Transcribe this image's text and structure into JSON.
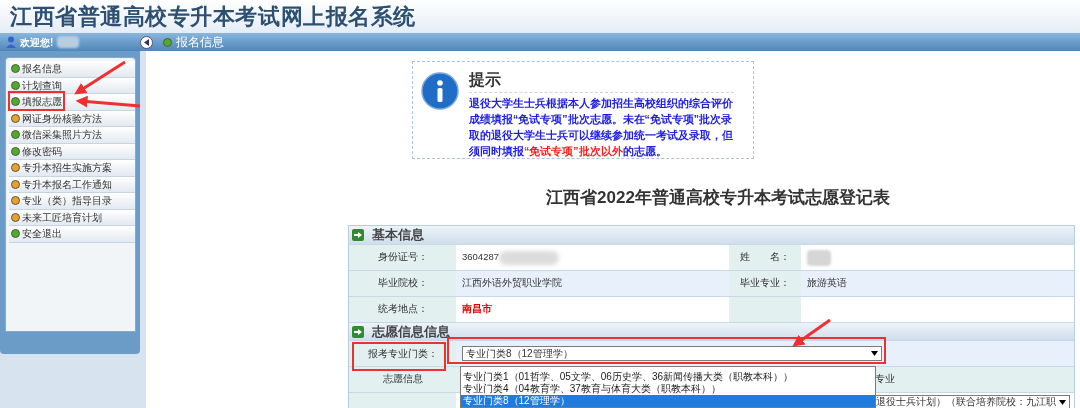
{
  "header": {
    "title": "江西省普通高校专升本考试网上报名系统"
  },
  "nav_bar": {
    "welcome": "欢迎您!",
    "breadcrumb": "报名信息"
  },
  "sidebar": {
    "items": [
      {
        "label": "报名信息",
        "color": "#4caf1e"
      },
      {
        "label": "计划查询",
        "color": "#4caf1e"
      },
      {
        "label": "填报志愿",
        "color": "#4caf1e"
      },
      {
        "label": "网证身份核验方法",
        "color": "#f0a020"
      },
      {
        "label": "微信采集照片方法",
        "color": "#4caf1e"
      },
      {
        "label": "修改密码",
        "color": "#4caf1e"
      },
      {
        "label": "专升本招生实施方案",
        "color": "#f0a020"
      },
      {
        "label": "专升本报名工作通知",
        "color": "#f0a020"
      },
      {
        "label": "专业（类）指导目录",
        "color": "#f0a020"
      },
      {
        "label": "未来工匠培育计划",
        "color": "#f0a020"
      },
      {
        "label": "安全退出",
        "color": "#4caf1e"
      }
    ]
  },
  "notice": {
    "title": "提示",
    "segments": [
      {
        "text": "退役大学生士兵根据本人参加招生高校组织的综合评价成绩填报“免试专项”批次志愿。未在“免试专项”批次录取的退役大学生士兵可以继续参加统一考试及录取，但须同时填报",
        "emphasis": false
      },
      {
        "text": "“免试专项”批次以外",
        "emphasis": true
      },
      {
        "text": "的志愿。",
        "emphasis": false
      }
    ]
  },
  "form": {
    "title": "江西省2022年普通高校专升本考试志愿登记表",
    "basic_section": "基本信息",
    "basic_rows": [
      {
        "label": "身份证号：",
        "value": "3604287",
        "value_blurred": true,
        "label_2": "姓　　名：",
        "value_2_blurred": true
      },
      {
        "label": "毕业院校：",
        "value": "江西外语外贸职业学院",
        "label_2": "毕业专业：",
        "value_2": "旅游英语"
      },
      {
        "label": "统考地点：",
        "value": "南昌市",
        "value_emphasis": true
      }
    ],
    "wish_section": "志愿信息信息",
    "category_label": "报考专业门类：",
    "category_value": "专业门类8（12管理学）",
    "category_options": [
      {
        "label": "专业门类1（01哲学、05文学、06历史学、36新闻传播大类（职教本科））",
        "selected": false
      },
      {
        "label": "专业门类4（04教育学、37教育与体育大类（职教本科））",
        "selected": false
      },
      {
        "label": "专业门类8（12管理学）",
        "selected": true
      }
    ],
    "wish_columns": [
      "志愿信息",
      "专业"
    ],
    "wish_row_value": "退役士兵计划）（联合培养院校：九江职"
  }
}
